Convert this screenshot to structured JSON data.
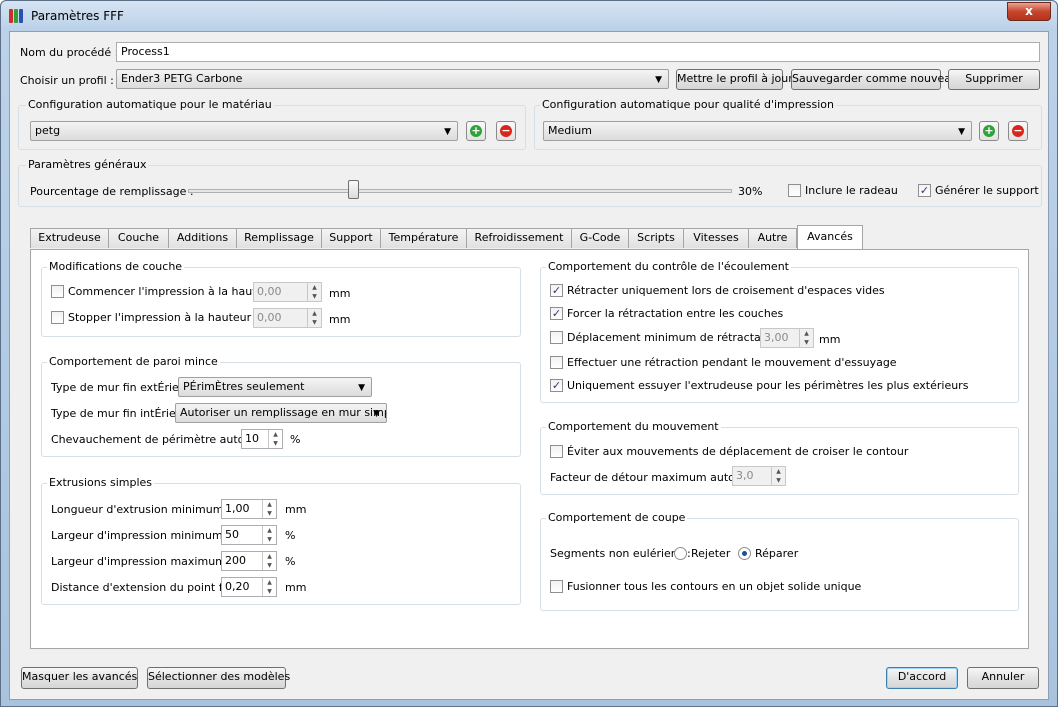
{
  "window": {
    "title": "Paramètres FFF",
    "close_label": "x",
    "icon_colors": [
      "#d42a2a",
      "#2f9e3b",
      "#2a4fb5"
    ]
  },
  "process": {
    "name_label": "Nom du procédé :",
    "name_value": "Process1",
    "profile_label": "Choisir un profil :",
    "profile_value": "Ender3 PETG Carbone",
    "update_button": "Mettre le profil à jour",
    "save_new_button": "Sauvegarder comme nouveau",
    "delete_button": "Supprimer"
  },
  "auto_material": {
    "title": "Configuration automatique pour le matériau",
    "value": "petg"
  },
  "auto_quality": {
    "title": "Configuration automatique pour qualité d'impression",
    "value": "Medium"
  },
  "general": {
    "title": "Paramètres généraux",
    "infill_label": "Pourcentage de remplissage :",
    "infill_value": "30%",
    "infill_fraction": 0.3,
    "raft_label": "Inclure le radeau",
    "raft_checked": false,
    "support_label": "Générer le support",
    "support_checked": true
  },
  "tabs": [
    "Extrudeuse",
    "Couche",
    "Additions",
    "Remplissage",
    "Support",
    "Température",
    "Refroidissement",
    "G-Code",
    "Scripts",
    "Vitesses",
    "Autre",
    "Avancés"
  ],
  "active_tab": "Avancés",
  "layer_mods": {
    "title": "Modifications de couche",
    "start_label": "Commencer l'impression à la hauteur",
    "start_value": "0,00",
    "start_unit": "mm",
    "stop_label": "Stopper  l'impression à la hauteur",
    "stop_value": "0,00",
    "stop_unit": "mm"
  },
  "thin_wall": {
    "title": "Comportement de paroi mince",
    "outer_label": "Type de mur fin extÉrieur",
    "outer_value": "PÉrimÈtres seulement",
    "inner_label": "Type de mur fin intÉrieur",
    "inner_value": "Autoriser un remplissage en mur simple",
    "overlap_label": "Chevauchement de périmètre autorisé",
    "overlap_value": "10",
    "overlap_unit": "%"
  },
  "single_ext": {
    "title": "Extrusions simples",
    "min_len_label": "Longueur d'extrusion minimum",
    "min_len_value": "1,00",
    "min_len_unit": "mm",
    "min_width_label": "Largeur d'impression minimum",
    "min_width_value": "50",
    "min_width_unit": "%",
    "max_width_label": "Largeur d'impression maximum",
    "max_width_value": "200",
    "max_width_unit": "%",
    "endpoint_label": "Distance d'extension du point final",
    "endpoint_value": "0,20",
    "endpoint_unit": "mm"
  },
  "flow": {
    "title": "Comportement du contrôle de l'écoulement",
    "retract_open_label": "Rétracter uniquement lors de croisement d'espaces vides",
    "retract_open_checked": true,
    "force_retract_label": "Forcer la rétractation entre les couches",
    "force_retract_checked": true,
    "min_travel_label": "Déplacement minimum de rétractation",
    "min_travel_checked": false,
    "min_travel_value": "3,00",
    "min_travel_unit": "mm",
    "wipe_retract_label": "Effectuer une rétraction pendant le mouvement d'essuyage",
    "wipe_retract_checked": false,
    "wipe_outer_label": "Uniquement essuyer l'extrudeuse pour les périmètres les plus extérieurs",
    "wipe_outer_checked": true
  },
  "movement": {
    "title": "Comportement du mouvement",
    "avoid_label": "Éviter aux mouvements de déplacement de croiser le contour",
    "avoid_checked": false,
    "detour_label": "Facteur de détour maximum autorisé",
    "detour_value": "3,0"
  },
  "slicing": {
    "title": "Comportement de coupe",
    "segments_label": "Segments non eulériens :",
    "reject_label": "Rejeter",
    "reject_selected": false,
    "repair_label": "Réparer",
    "repair_selected": true,
    "merge_label": "Fusionner tous les contours en un objet solide unique",
    "merge_checked": false
  },
  "footer": {
    "hide_advanced": "Masquer les avancés",
    "select_models": "Sélectionner des modèles",
    "ok": "D'accord",
    "cancel": "Annuler"
  }
}
